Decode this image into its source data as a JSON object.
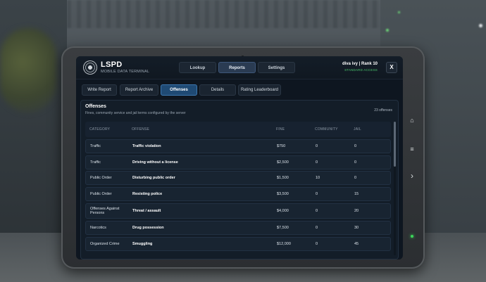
{
  "header": {
    "brand": "LSPD",
    "brand_sub": "MOBILE DATA TERMINAL",
    "nav": [
      {
        "label": "Lookup",
        "active": false
      },
      {
        "label": "Reports",
        "active": true
      },
      {
        "label": "Settings",
        "active": false
      }
    ],
    "user_line": "diva ivy | Rank 10",
    "access": "STANDARD ACCESS",
    "close_label": "X"
  },
  "subtabs": [
    {
      "label": "Write Report",
      "active": false
    },
    {
      "label": "Report Archive",
      "active": false
    },
    {
      "label": "Offenses",
      "active": true
    },
    {
      "label": "Details",
      "active": false
    },
    {
      "label": "Rating Leaderboard",
      "active": false
    }
  ],
  "panel": {
    "title": "Offenses",
    "subtitle": "Fines, community service and jail terms configured by the server",
    "count": "23 offenses"
  },
  "table": {
    "columns": [
      "CATEGORY",
      "OFFENSE",
      "FINE",
      "COMMUNITY",
      "JAIL"
    ],
    "rows": [
      {
        "category": "Traffic",
        "offense": "Traffic violation",
        "fine": "$750",
        "community": "0",
        "jail": "0"
      },
      {
        "category": "Traffic",
        "offense": "Driving without a license",
        "fine": "$2,500",
        "community": "0",
        "jail": "0"
      },
      {
        "category": "Public Order",
        "offense": "Disturbing public order",
        "fine": "$1,500",
        "community": "10",
        "jail": "0"
      },
      {
        "category": "Public Order",
        "offense": "Resisting police",
        "fine": "$3,500",
        "community": "0",
        "jail": "15"
      },
      {
        "category": "Offenses Against Persons",
        "offense": "Threat / assault",
        "fine": "$4,000",
        "community": "0",
        "jail": "20"
      },
      {
        "category": "Narcotics",
        "offense": "Drug possession",
        "fine": "$7,500",
        "community": "0",
        "jail": "30"
      },
      {
        "category": "Organized Crime",
        "offense": "Smuggling",
        "fine": "$12,000",
        "community": "0",
        "jail": "45"
      }
    ]
  },
  "side_buttons": [
    {
      "icon": "home-icon",
      "glyph": "⌂"
    },
    {
      "icon": "menu-icon",
      "glyph": "≡"
    },
    {
      "icon": "chevron-right-icon",
      "glyph": "›"
    }
  ],
  "colors": {
    "accent": "#1f4a74",
    "access_green": "#49c46a",
    "power_led": "#3bd65a"
  }
}
